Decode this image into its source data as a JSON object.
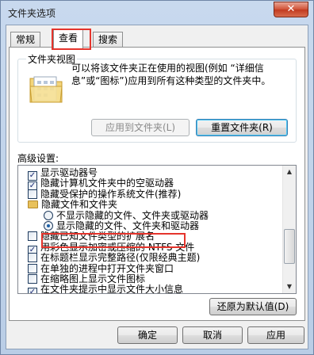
{
  "window": {
    "title": "文件夹选项",
    "close_glyph": "✕"
  },
  "tabs": [
    {
      "label": "常规"
    },
    {
      "label": "查看"
    },
    {
      "label": "搜索"
    }
  ],
  "folder_views": {
    "legend": "文件夹视图",
    "description": "可以将该文件夹正在使用的视图(例如 “详细信息”或“图标”)应用到所有这种类型的文件夹中。",
    "apply_button": "应用到文件夹(L)",
    "reset_button": "重置文件夹(R)"
  },
  "advanced": {
    "label": "高级设置:",
    "items": [
      {
        "kind": "checkbox",
        "checked": true,
        "indent": 0,
        "label": "显示驱动器号"
      },
      {
        "kind": "checkbox",
        "checked": true,
        "indent": 0,
        "label": "隐藏计算机文件夹中的空驱动器"
      },
      {
        "kind": "checkbox",
        "checked": false,
        "indent": 0,
        "label": "隐藏受保护的操作系统文件(推荐)"
      },
      {
        "kind": "folder",
        "checked": false,
        "indent": 0,
        "label": "隐藏文件和文件夹"
      },
      {
        "kind": "radio",
        "checked": false,
        "indent": 1,
        "label": "不显示隐藏的文件、文件夹或驱动器"
      },
      {
        "kind": "radio",
        "checked": true,
        "indent": 1,
        "label": "显示隐藏的文件、文件夹和驱动器"
      },
      {
        "kind": "checkbox",
        "checked": false,
        "indent": 0,
        "label": "隐藏已知文件类型的扩展名"
      },
      {
        "kind": "checkbox",
        "checked": true,
        "indent": 0,
        "label": "用彩色显示加密或压缩的 NTFS 文件"
      },
      {
        "kind": "checkbox",
        "checked": false,
        "indent": 0,
        "label": "在标题栏显示完整路径(仅限经典主题)"
      },
      {
        "kind": "checkbox",
        "checked": false,
        "indent": 0,
        "label": "在单独的进程中打开文件夹窗口"
      },
      {
        "kind": "checkbox",
        "checked": false,
        "indent": 0,
        "label": "在缩略图上显示文件图标"
      },
      {
        "kind": "checkbox",
        "checked": true,
        "indent": 0,
        "label": "在文件夹提示中显示文件大小信息"
      },
      {
        "kind": "checkbox",
        "checked": true,
        "indent": 0,
        "label": "在预览窗格中显示预览句柄"
      }
    ],
    "restore_button": "还原为默认值(D)"
  },
  "footer": {
    "ok_button": "确定",
    "cancel_button": "取消",
    "apply_button": "应用"
  },
  "colors": {
    "highlight": "#e5342c"
  }
}
